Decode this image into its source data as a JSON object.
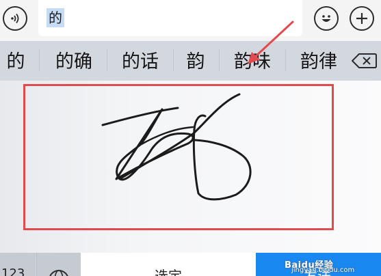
{
  "input": {
    "text": "的"
  },
  "candidates": [
    "的",
    "的确",
    "的话",
    "韵",
    "韵味",
    "韵律"
  ],
  "bottom_keys": {
    "numbers": "123",
    "select": "选定",
    "send": "发送"
  },
  "watermark": {
    "logo": "Baidu经验",
    "site": "jingyan.baidu.com"
  },
  "colors": {
    "highlight_border": "#e24b4e",
    "arrow": "#e24b4e",
    "send_key": "#1a88f1",
    "selection": "#c6dcf5"
  },
  "icons": [
    "voice-icon",
    "emoji-icon",
    "plus-icon",
    "backspace-icon",
    "globe-icon",
    "annotation-arrow"
  ]
}
